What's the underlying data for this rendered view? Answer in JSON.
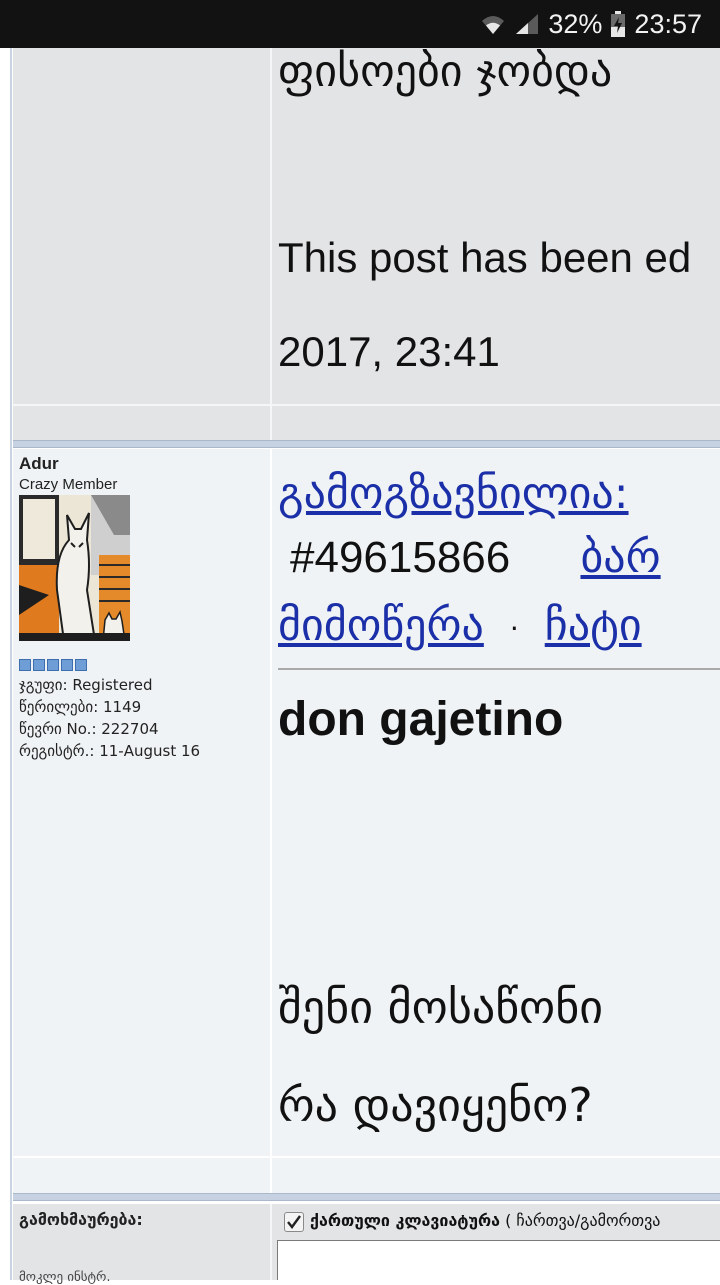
{
  "status_bar": {
    "battery": "32%",
    "time": "23:57",
    "wifi_icon": "wifi-icon",
    "signal_icon": "signal-icon",
    "battery_icon": "battery-charging-icon"
  },
  "post1": {
    "text_line": "ფისოები ჯობდა",
    "edited_line1": "This post has been ed",
    "edited_line2": "2017, 23:41"
  },
  "post2": {
    "author": "Adur",
    "rank": "Crazy Member",
    "pips": 5,
    "meta": [
      "ჯგუფი: Registered",
      "წერილები: 1149",
      "წევრი No.: 222704",
      "რეგისტრ.: 11-August 16"
    ],
    "header_link1": "გამოგზავნილია:",
    "post_id": "#49615866",
    "header_link2": "ბარ",
    "header_link3": "მიმოწერა",
    "dot": "·",
    "header_link4": "ჩატი",
    "quote_name": "don gajetino",
    "body_line1": "შენი მოსაწონი",
    "body_line2": "რა დავიყენო? "
  },
  "reply": {
    "label": "გამოხმაურება:",
    "checkbox_label": "ქართული კლავიატურა",
    "checkbox_extra": "( ჩართვა/გამორთვა",
    "sub_label": "მოკლე ინსტრ.",
    "checkbox_checked": true
  }
}
